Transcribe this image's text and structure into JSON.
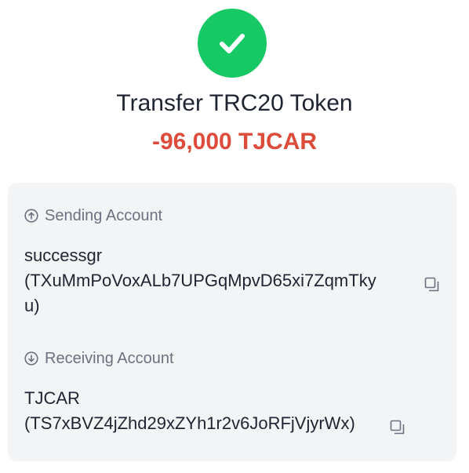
{
  "header": {
    "status_icon": "check-icon",
    "status_color": "#17c964",
    "title": "Transfer TRC20 Token",
    "amount": "-96,000 TJCAR",
    "amount_color": "#dd4b3a"
  },
  "sending": {
    "label": "Sending Account",
    "label_icon": "arrow-up-circle-icon",
    "name": "successgr",
    "address_line1": "(TXuMmPoVoxALb7UPGqMpvD65xi7ZqmTky",
    "address_line2": "u)",
    "copy_icon": "copy-icon"
  },
  "receiving": {
    "label": "Receiving Account",
    "label_icon": "arrow-down-circle-icon",
    "name": "TJCAR",
    "address_line1": "(TS7xBVZ4jZhd29xZYh1r2v6JoRFjVjyrWx)",
    "copy_icon": "copy-icon"
  }
}
